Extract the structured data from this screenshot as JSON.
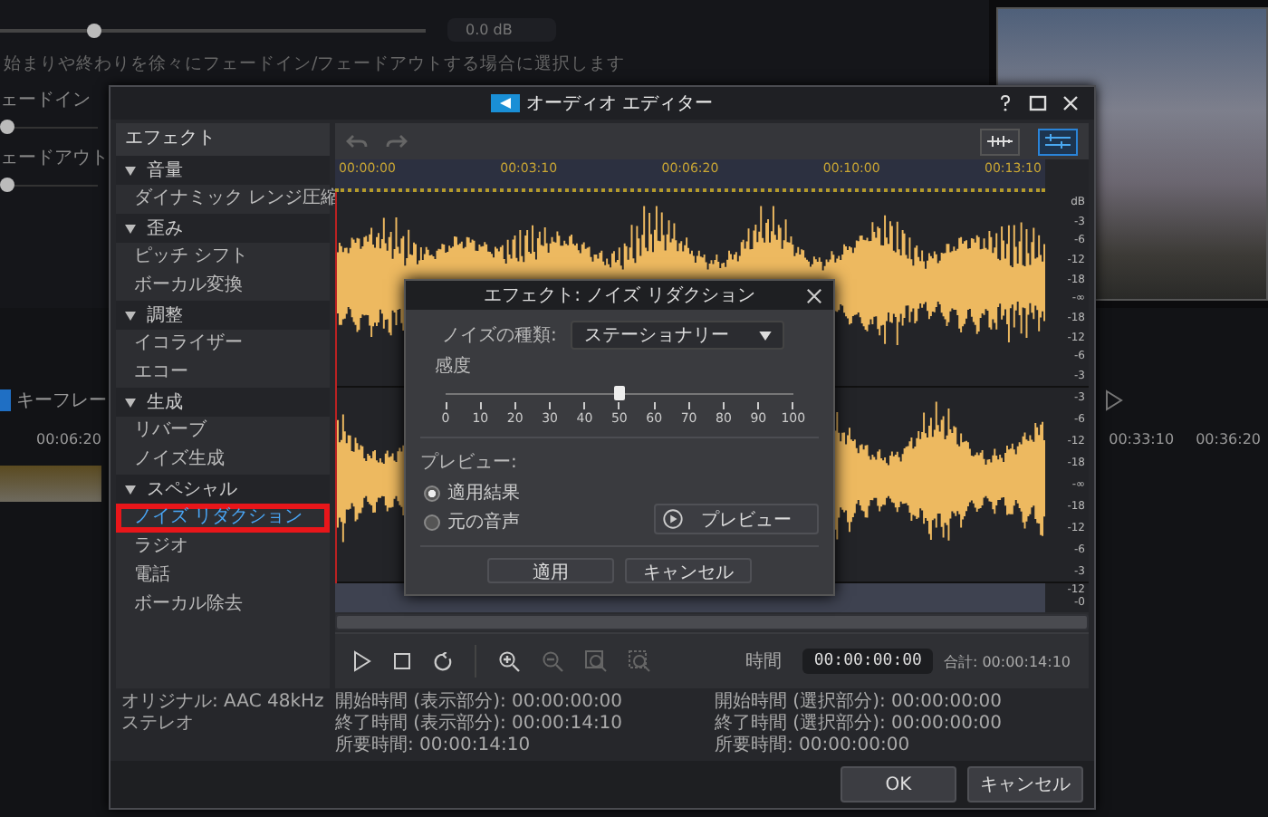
{
  "background": {
    "volume": {
      "level": 0.22
    },
    "fades": [
      {
        "level": 0
      },
      {
        "level": 0
      }
    ],
    "volume_value": "0.0 dB",
    "hint": "始まりや終わりを徐々にフェードイン/フェードアウトする場合に選択します",
    "fade_labels": [
      "ェードイン",
      "ェードアウト"
    ],
    "timeline_label": "キーフレー",
    "timeline_times": [
      "00:06:20",
      "00:33:10",
      "00:36:20"
    ]
  },
  "editor": {
    "title": "オーディオ エディター",
    "sidebar": {
      "header": "エフェクト",
      "groups": [
        {
          "label": "音量",
          "expanded": true,
          "children": [
            {
              "label": "ダイナミック レンジ圧縮",
              "selected": false
            }
          ]
        },
        {
          "label": "歪み",
          "expanded": true,
          "children": [
            {
              "label": "ピッチ シフト",
              "selected": false
            },
            {
              "label": "ボーカル変換",
              "selected": false
            }
          ]
        },
        {
          "label": "調整",
          "expanded": true,
          "children": [
            {
              "label": "イコライザー",
              "selected": false
            },
            {
              "label": "エコー",
              "selected": false
            }
          ]
        },
        {
          "label": "生成",
          "expanded": true,
          "children": [
            {
              "label": "リバーブ",
              "selected": false
            },
            {
              "label": "ノイズ生成",
              "selected": false
            }
          ]
        },
        {
          "label": "スペシャル",
          "expanded": true,
          "children": [
            {
              "label": "ノイズ リダクション",
              "selected": true
            },
            {
              "label": "ラジオ",
              "selected": false
            },
            {
              "label": "電話",
              "selected": false
            },
            {
              "label": "ボーカル除去",
              "selected": false
            }
          ]
        }
      ]
    },
    "view_modes": [
      {
        "selected": false
      },
      {
        "selected": true
      }
    ],
    "ruler": [
      "00:00:00",
      "00:03:10",
      "00:06:20",
      "00:10:00",
      "00:13:10"
    ],
    "db_scales": [
      [
        "dB",
        "-3",
        "-6",
        "-12",
        "-18",
        "-∞",
        "-18",
        "-12",
        "-6",
        "-3"
      ],
      [
        "-3",
        "-6",
        "-12",
        "-18",
        "-∞",
        "-18",
        "-12",
        "-6",
        "-3"
      ]
    ],
    "overview_scale": [
      "-12",
      "-0"
    ],
    "time_label": "時間",
    "time_value": "00:00:00:00",
    "total": "合計: 00:00:14:10",
    "info_left": [
      "オリジナル: AAC 48kHz",
      "ステレオ"
    ],
    "info_view": [
      "開始時間 (表示部分): 00:00:00:00",
      "終了時間 (表示部分): 00:00:14:10",
      "所要時間: 00:00:14:10"
    ],
    "info_selection": [
      "開始時間 (選択部分): 00:00:00:00",
      "終了時間 (選択部分): 00:00:00:00",
      "所要時間: 00:00:00:00"
    ],
    "buttons": [
      "OK",
      "キャンセル"
    ]
  },
  "noise_dialog": {
    "title": "エフェクト: ノイズ リダクション",
    "type_label": "ノイズの種類:",
    "type_value": "ステーショナリー",
    "sensitivity_label": "感度",
    "sensitivity": {
      "level": 0.5,
      "ticks": [
        "0",
        "10",
        "20",
        "30",
        "40",
        "50",
        "60",
        "70",
        "80",
        "90",
        "100"
      ]
    },
    "preview_label": "プレビュー:",
    "options": [
      {
        "label": "適用結果",
        "selected": true
      },
      {
        "label": "元の音声",
        "selected": false
      }
    ],
    "preview_button": "プレビュー",
    "buttons": [
      "適用",
      "キャンセル"
    ]
  }
}
